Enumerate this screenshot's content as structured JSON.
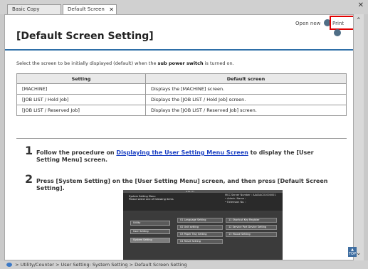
{
  "tabs": [
    {
      "label": "Basic Copy Procedure"
    },
    {
      "label": "Default Screen Set...",
      "close": "✕"
    }
  ],
  "window_close": "✕",
  "toolbar": {
    "open_new": "Open new",
    "print": "Print"
  },
  "page": {
    "title": "[Default Screen Setting]",
    "intro_prefix": "Select the screen to be initially displayed (default) when the ",
    "intro_bold": "sub power switch",
    "intro_suffix": " is turned on."
  },
  "table": {
    "headers": [
      "Setting",
      "Default screen"
    ],
    "rows": [
      [
        "[MACHINE]",
        "Displays the [MACHINE] screen."
      ],
      [
        "[JOB LIST / Hold Job]",
        "Displays the [JOB LIST / Hold Job] screen."
      ],
      [
        "[JOB LIST / Reserved Job]",
        "Displays the [JOB LIST / Reserved Job] screen."
      ]
    ]
  },
  "steps": [
    {
      "num": "1",
      "pre": "Follow the procedure on ",
      "link": "Displaying the User Setting Menu Screen",
      "post": " to display the [User Setting Menu] screen."
    },
    {
      "num": "2",
      "text": "Press [System Setting] on the [User Setting Menu] screen, and then press [Default Screen Setting]."
    }
  ],
  "device": {
    "header": "UTIL ITY",
    "menu_title_1": "System Setting Menu",
    "menu_title_2": "Please select one of following items",
    "server_1": "MCC Server Number : AAAAAC01000001",
    "server_2": "• Admin. Name :",
    "server_3": "• Extension No. :",
    "left_buttons": [
      "Utility",
      "User Setting",
      "System Setting"
    ],
    "grid_buttons": [
      "01 Language Setting",
      "11 Shortcut Key Register",
      "02 Unit setting",
      "12 Service Port Device Setting",
      "03 Paper Tray Setting",
      "13 Mouse Setting",
      "04 Reset Setting"
    ]
  },
  "scroll": {
    "up": "⌃",
    "down": "⌄",
    "top_label": "TOP"
  },
  "breadcrumb": {
    "items": [
      "Utility/Counter",
      "User Setting: System Setting",
      "Default Screen Setting"
    ],
    "separator": ">"
  },
  "colors": {
    "accent_rule": "#2e6fa8",
    "link": "#1a3fc2",
    "print_highlight": "#e00000"
  }
}
